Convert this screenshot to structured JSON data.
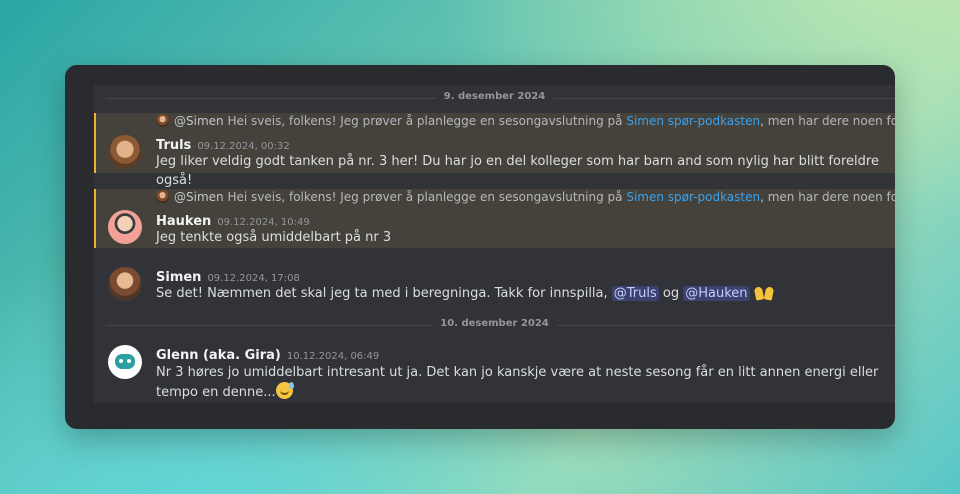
{
  "dividers": {
    "d1": "9. desember 2024",
    "d2": "10. desember 2024"
  },
  "reply_preview": {
    "mention": "@Simen",
    "text_before": "Hei sveis, folkens! Jeg prøver å planlegge en sesongavslutning på ",
    "link": "Simen spør-podkasten",
    "text_after": ", men har dere noen forslag til format..."
  },
  "messages": [
    {
      "author": "Truls",
      "time": "09.12.2024, 00:32",
      "text": "Jeg liker veldig godt tanken på nr. 3 her! Du har jo en del kolleger som har barn and som nylig har blitt foreldre også!"
    },
    {
      "author": "Hauken",
      "time": "09.12.2024, 10:49",
      "text": "Jeg tenkte også umiddelbart på nr 3"
    },
    {
      "author": "Simen",
      "time": "09.12.2024, 17:08",
      "text_before": "Se det! Næmmen det skal jeg ta med i beregninga. Takk for innspilla, ",
      "mention1": "@Truls",
      "text_mid": " og ",
      "mention2": "@Hauken"
    },
    {
      "author": "Glenn (aka. Gira)",
      "time": "10.12.2024, 06:49",
      "text": "Nr 3 høres jo umiddelbart intresant ut ja. Det kan jo kanskje være at neste sesong får en litt annen energi eller tempo en denne..."
    }
  ],
  "icons": {
    "simen_emoji": "raised-hands-emoji",
    "glenn_emoji": "sweat-smile-emoji",
    "glenn_avatar": "gira-bot-avatar-icon"
  },
  "colors": {
    "highlight_bar": "#f0b232",
    "link": "#3aa2ee",
    "mention_bg": "#3c4270"
  }
}
